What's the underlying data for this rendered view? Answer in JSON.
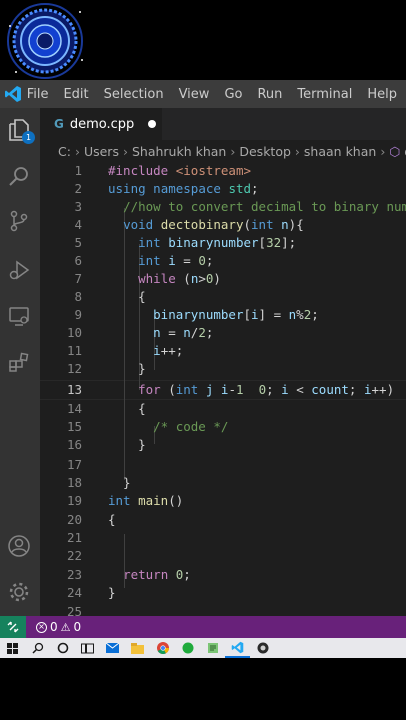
{
  "menu": [
    "File",
    "Edit",
    "Selection",
    "View",
    "Go",
    "Run",
    "Terminal",
    "Help"
  ],
  "activity_bar": {
    "explorer_badge": "1",
    "icons": [
      "explorer-icon",
      "search-icon",
      "source-control-icon",
      "run-debug-icon",
      "remote-explorer-icon",
      "extensions-icon",
      "account-icon",
      "settings-gear-icon"
    ]
  },
  "tab": {
    "label": "demo.cpp",
    "modified": true
  },
  "breadcrumb": [
    "C:",
    "Users",
    "Shahrukh khan",
    "Desktop",
    "shaan khan",
    "dec"
  ],
  "editor": {
    "active_line": "13",
    "line_numbers": [
      "1",
      "2",
      "3",
      "4",
      "5",
      "6",
      "7",
      "8",
      "9",
      "10",
      "11",
      "12",
      "13",
      "14",
      "15",
      "16",
      "17",
      "18",
      "19",
      "20",
      "21",
      "22",
      "23",
      "24",
      "25"
    ]
  },
  "status": {
    "errors": "0",
    "warnings": "0"
  },
  "colors": {
    "statusbar": "#68217a",
    "remote": "#16825d",
    "editor_bg": "#1e1e1e",
    "badge": "#0e70c0"
  }
}
